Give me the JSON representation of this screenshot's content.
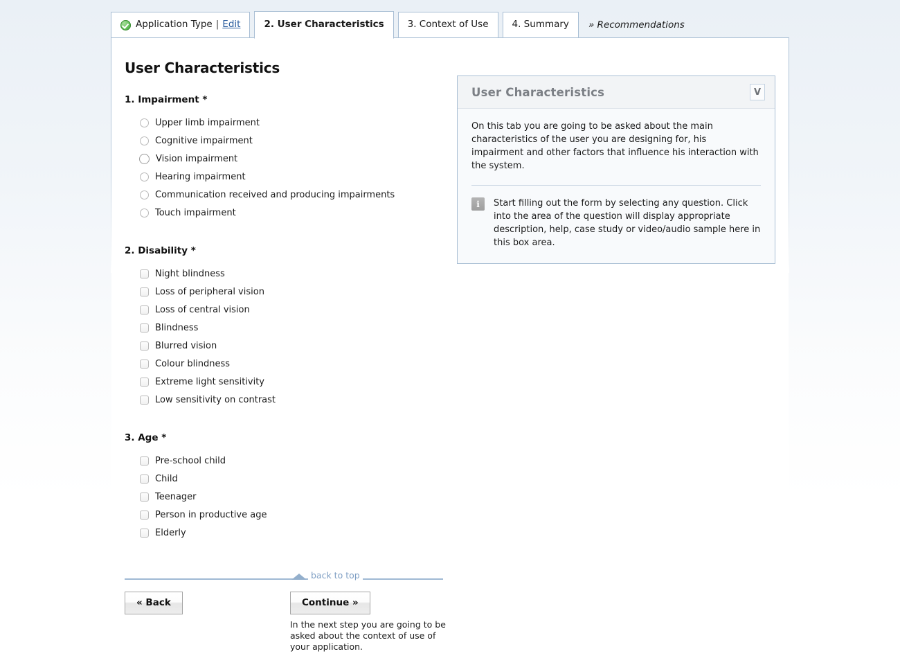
{
  "tabs": [
    {
      "label": "Application Type",
      "icon": "check-circle-icon",
      "separator": "|",
      "edit_label": "Edit",
      "state": "completed"
    },
    {
      "label": "2. User Characteristics",
      "state": "active"
    },
    {
      "label": "3. Context of Use",
      "state": "inactive"
    },
    {
      "label": "4. Summary",
      "state": "inactive"
    },
    {
      "label": "» Recommendations",
      "state": "link"
    }
  ],
  "page": {
    "title": "User Characteristics"
  },
  "questions": [
    {
      "title": "1. Impairment *",
      "input_type": "radio",
      "options": [
        {
          "label": "Upper limb impairment",
          "checked": false,
          "focused": false
        },
        {
          "label": "Cognitive impairment",
          "checked": false,
          "focused": false
        },
        {
          "label": "Vision impairment",
          "checked": false,
          "focused": true
        },
        {
          "label": "Hearing impairment",
          "checked": false,
          "focused": false
        },
        {
          "label": "Communication received and producing impairments",
          "checked": false,
          "focused": false
        },
        {
          "label": "Touch impairment",
          "checked": false,
          "focused": false
        }
      ]
    },
    {
      "title": "2. Disability *",
      "input_type": "checkbox",
      "options": [
        {
          "label": "Night blindness",
          "checked": false
        },
        {
          "label": "Loss of peripheral vision",
          "checked": false
        },
        {
          "label": "Loss of central vision",
          "checked": false
        },
        {
          "label": "Blindness",
          "checked": false
        },
        {
          "label": "Blurred vision",
          "checked": false
        },
        {
          "label": "Colour blindness",
          "checked": false
        },
        {
          "label": "Extreme light sensitivity",
          "checked": false
        },
        {
          "label": "Low sensitivity on contrast",
          "checked": false
        }
      ]
    },
    {
      "title": "3. Age *",
      "input_type": "checkbox",
      "options": [
        {
          "label": "Pre-school child",
          "checked": false
        },
        {
          "label": "Child",
          "checked": false
        },
        {
          "label": "Teenager",
          "checked": false
        },
        {
          "label": "Person in productive age",
          "checked": false
        },
        {
          "label": "Elderly",
          "checked": false
        }
      ]
    }
  ],
  "infobox": {
    "title": "User Characteristics",
    "collapse_label": "V",
    "description": "On this tab you are going to be asked about the main characteristics of the user you are designing for, his impairment and other factors that influence his interaction with the system.",
    "hint_icon": "info-icon",
    "hint": "Start filling out the form by selecting any question. Click into the area of the question will display appropriate description, help, case study or video/audio sample here in this box area."
  },
  "footer": {
    "back_to_top": "back to top",
    "back_button": "« Back",
    "continue_button": "Continue »",
    "next_step_note": "In the next step you are going to be asked about the context of use of your application."
  },
  "colors": {
    "accent_border": "#a8bed4",
    "link": "#2a5d9e",
    "muted_link": "#7f9fc4",
    "success": "#63bf57",
    "panel_header_text": "#7b7f85"
  }
}
